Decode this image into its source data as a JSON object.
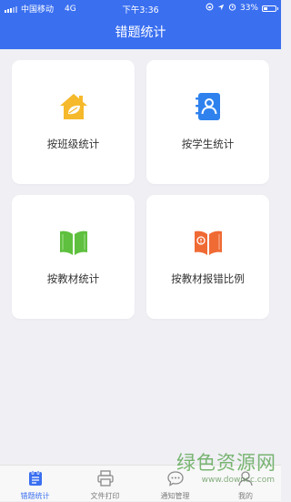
{
  "status_bar": {
    "carrier": "中国移动",
    "network": "4G",
    "time": "下午3:36",
    "battery": "33%",
    "battery_level": 0.33
  },
  "nav": {
    "title": "错题统计"
  },
  "cards": [
    {
      "label": "按班级统计",
      "icon": "house-leaf-icon",
      "color": "#f5b92b"
    },
    {
      "label": "按学生统计",
      "icon": "contact-book-icon",
      "color": "#2f82ee"
    },
    {
      "label": "按教材统计",
      "icon": "open-book-icon",
      "color": "#5ec03e"
    },
    {
      "label": "按教材报错比例",
      "icon": "open-book-alert-icon",
      "color": "#f06a34"
    }
  ],
  "tabs": [
    {
      "label": "错题统计",
      "icon": "report-icon",
      "active": true
    },
    {
      "label": "文件打印",
      "icon": "printer-icon",
      "active": false
    },
    {
      "label": "通知管理",
      "icon": "chat-bubble-icon",
      "active": false
    },
    {
      "label": "我的",
      "icon": "person-icon",
      "active": false
    }
  ],
  "watermark": {
    "text": "绿色资源网",
    "url": "www.downcc.com"
  },
  "colors": {
    "primary": "#3a6ff0",
    "background": "#efeff4"
  }
}
